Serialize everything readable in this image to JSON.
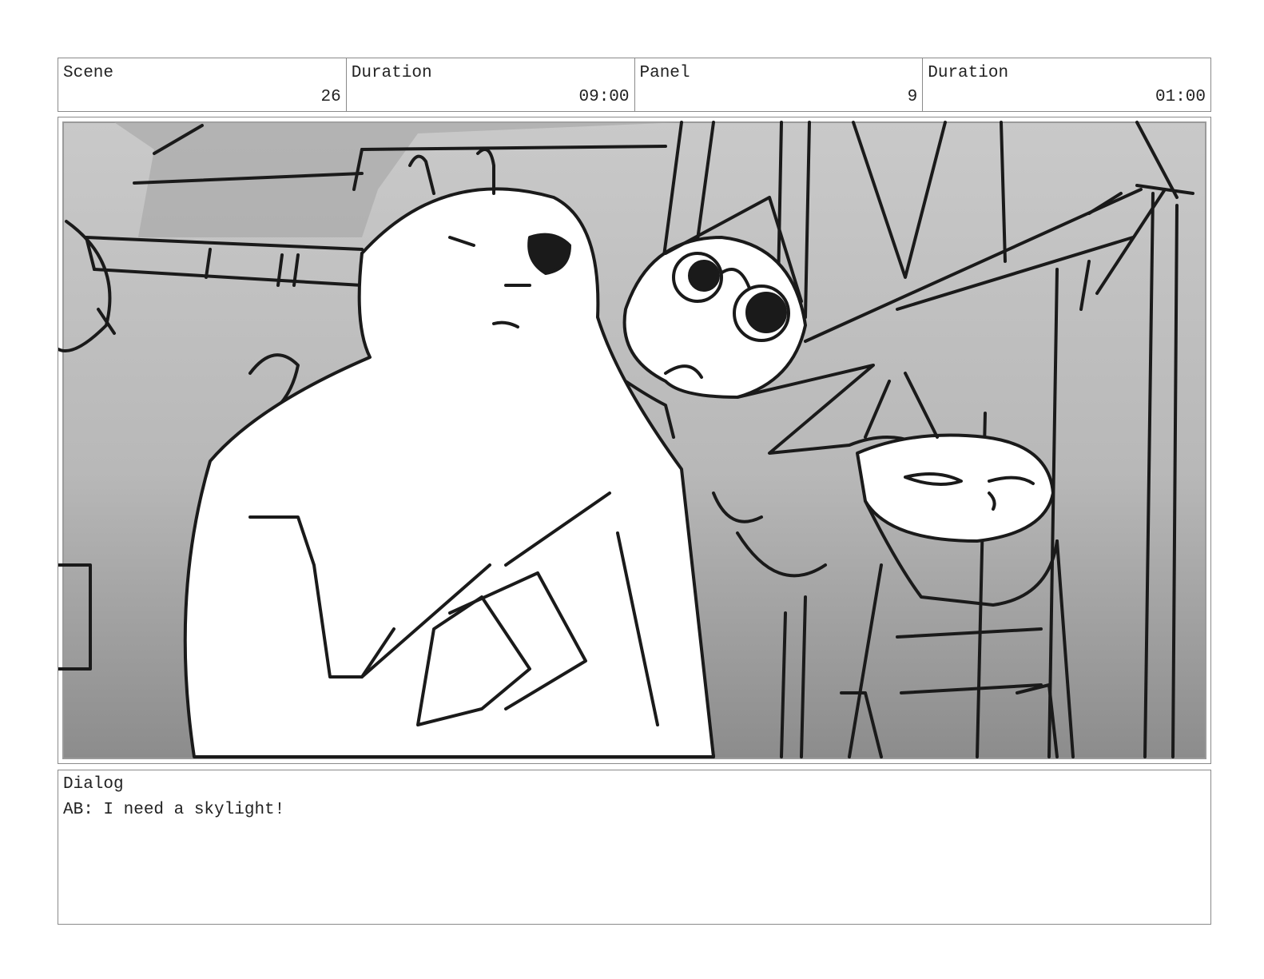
{
  "header": {
    "scene_label": "Scene",
    "scene_value": "26",
    "scene_duration_label": "Duration",
    "scene_duration_value": "09:00",
    "panel_label": "Panel",
    "panel_value": "9",
    "panel_duration_label": "Duration",
    "panel_duration_value": "01:00"
  },
  "panel_image": {
    "subject": "storyboard-sketch-drawing"
  },
  "dialog": {
    "label": "Dialog",
    "text": "AB: I need a skylight!"
  }
}
